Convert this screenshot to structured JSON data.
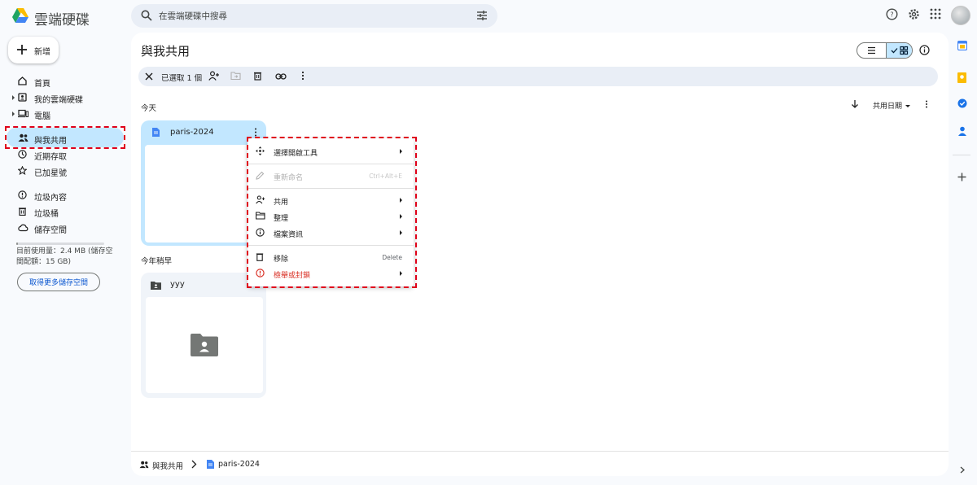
{
  "app": {
    "title": "雲端硬碟"
  },
  "search": {
    "placeholder": "在雲端硬碟中搜尋"
  },
  "sidebar": {
    "new_label": "新增",
    "items": [
      {
        "label": "首頁",
        "icon": "home-icon"
      },
      {
        "label": "我的雲端硬碟",
        "icon": "drive-icon"
      },
      {
        "label": "電腦",
        "icon": "computer-icon"
      },
      {
        "label": "與我共用",
        "icon": "shared-icon",
        "active": true
      },
      {
        "label": "近期存取",
        "icon": "clock-icon"
      },
      {
        "label": "已加星號",
        "icon": "star-icon"
      },
      {
        "label": "垃圾內容",
        "icon": "spam-icon"
      },
      {
        "label": "垃圾桶",
        "icon": "trash-icon"
      },
      {
        "label": "儲存空間",
        "icon": "cloud-icon"
      }
    ],
    "storage_text": "目前使用量：2.4 MB (儲存空間配額：15 GB)",
    "storage_used_fraction": 0.0002,
    "storage_button": "取得更多儲存空間"
  },
  "main": {
    "title": "與我共用",
    "toolbar": {
      "selected": "已選取 1 個"
    },
    "sort_label": "共用日期",
    "sections": [
      {
        "label": "今天",
        "items": [
          {
            "name": "paris-2024",
            "type": "document"
          }
        ]
      },
      {
        "label": "今年稍早",
        "items": [
          {
            "name": "yyy",
            "type": "shared-folder"
          }
        ]
      }
    ]
  },
  "context_menu": {
    "items": [
      {
        "label": "選擇開啟工具",
        "icon": "open-with-icon",
        "submenu": true
      },
      {
        "label": "重新命名",
        "icon": "rename-icon",
        "shortcut": "Ctrl+Alt+E",
        "disabled": true
      },
      {
        "label": "共用",
        "icon": "person-add-icon",
        "submenu": true
      },
      {
        "label": "整理",
        "icon": "folder-open-icon",
        "submenu": true
      },
      {
        "label": "檔案資訊",
        "icon": "info-icon",
        "submenu": true
      },
      {
        "label": "移除",
        "icon": "trash-icon",
        "shortcut": "Delete"
      },
      {
        "label": "檢舉或封鎖",
        "icon": "report-icon",
        "submenu": true,
        "danger": true
      }
    ]
  },
  "breadcrumb": {
    "root": "與我共用",
    "current": "paris-2024"
  },
  "colors": {
    "accent": "#0b57d0",
    "selected_bg": "#c2e7ff",
    "highlight_red": "#e0001a"
  }
}
